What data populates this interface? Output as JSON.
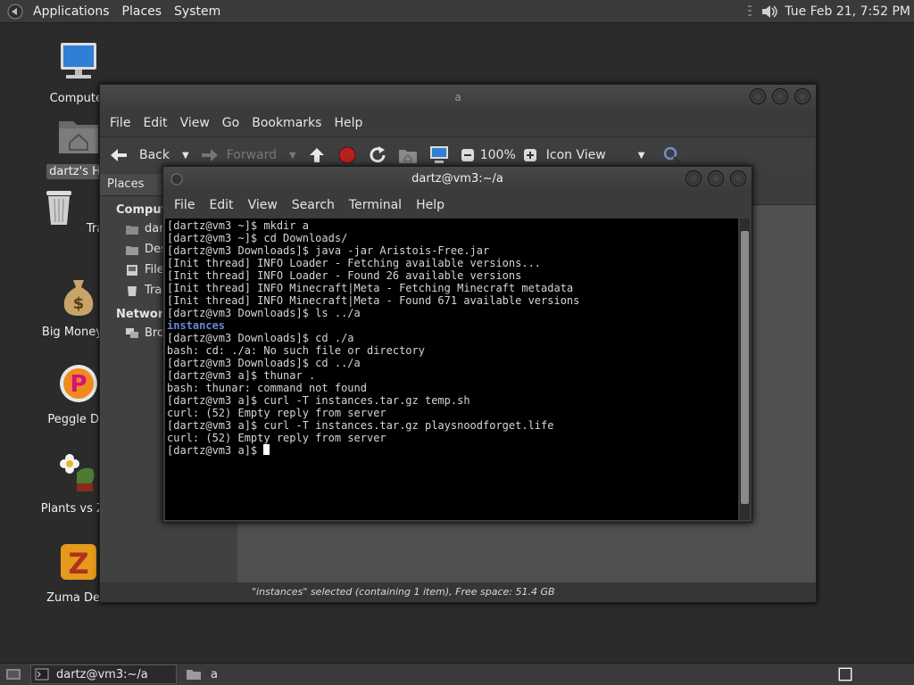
{
  "top_panel": {
    "menus": [
      "Applications",
      "Places",
      "System"
    ],
    "clock": "Tue Feb 21,  7:52 PM"
  },
  "desktop_icons": [
    {
      "label": "Computer",
      "icon": "computer-icon"
    },
    {
      "label": "dartz's Ho",
      "icon": "home-folder-icon"
    },
    {
      "label": "Trash",
      "icon": "trash-icon"
    },
    {
      "label": "Big Money D",
      "icon": "money-bag-icon"
    },
    {
      "label": "Peggle Del",
      "icon": "peggle-icon"
    },
    {
      "label": "Plants vs Zor",
      "icon": "plants-vs-zombies-icon"
    },
    {
      "label": "Zuma Delu",
      "icon": "zuma-icon"
    }
  ],
  "file_manager": {
    "title": "a",
    "menu": [
      "File",
      "Edit",
      "View",
      "Go",
      "Bookmarks",
      "Help"
    ],
    "toolbar": {
      "back": "Back",
      "forward": "Forward",
      "zoom": "100%",
      "view_mode": "Icon View"
    },
    "sidebar": {
      "header": "Places",
      "sections": [
        {
          "title": "Compute",
          "items": [
            {
              "label": "dar",
              "icon": "home-icon"
            },
            {
              "label": "Des",
              "icon": "desktop-icon"
            },
            {
              "label": "File",
              "icon": "filesystem-icon"
            },
            {
              "label": "Tra",
              "icon": "trash-icon"
            }
          ]
        },
        {
          "title": "Network",
          "items": [
            {
              "label": "Bro",
              "icon": "network-icon"
            }
          ]
        }
      ]
    },
    "status": "\"instances\" selected (containing 1 item), Free space: 51.4 GB"
  },
  "terminal": {
    "title": "dartz@vm3:~/a",
    "menu": [
      "File",
      "Edit",
      "View",
      "Search",
      "Terminal",
      "Help"
    ],
    "lines": [
      "[dartz@vm3 ~]$ mkdir a",
      "[dartz@vm3 ~]$ cd Downloads/",
      "[dartz@vm3 Downloads]$ java -jar Aristois-Free.jar",
      "[Init thread] INFO Loader - Fetching available versions...",
      "[Init thread] INFO Loader - Found 26 available versions",
      "[Init thread] INFO Minecraft|Meta - Fetching Minecraft metadata",
      "[Init thread] INFO Minecraft|Meta - Found 671 available versions",
      "[dartz@vm3 Downloads]$ ls ../a",
      "instances",
      "[dartz@vm3 Downloads]$ cd ./a",
      "bash: cd: ./a: No such file or directory",
      "[dartz@vm3 Downloads]$ cd ../a",
      "[dartz@vm3 a]$ thunar .",
      "bash: thunar: command not found",
      "[dartz@vm3 a]$ curl -T instances.tar.gz temp.sh",
      "curl: (52) Empty reply from server",
      "[dartz@vm3 a]$ curl -T instances.tar.gz playsnoodforget.life",
      "curl: (52) Empty reply from server",
      "[dartz@vm3 a]$ "
    ]
  },
  "bottom_panel": {
    "tasks": [
      {
        "label": "dartz@vm3:~/a",
        "icon": "terminal-icon",
        "active": true
      },
      {
        "label": "a",
        "icon": "folder-icon",
        "active": false
      }
    ]
  }
}
